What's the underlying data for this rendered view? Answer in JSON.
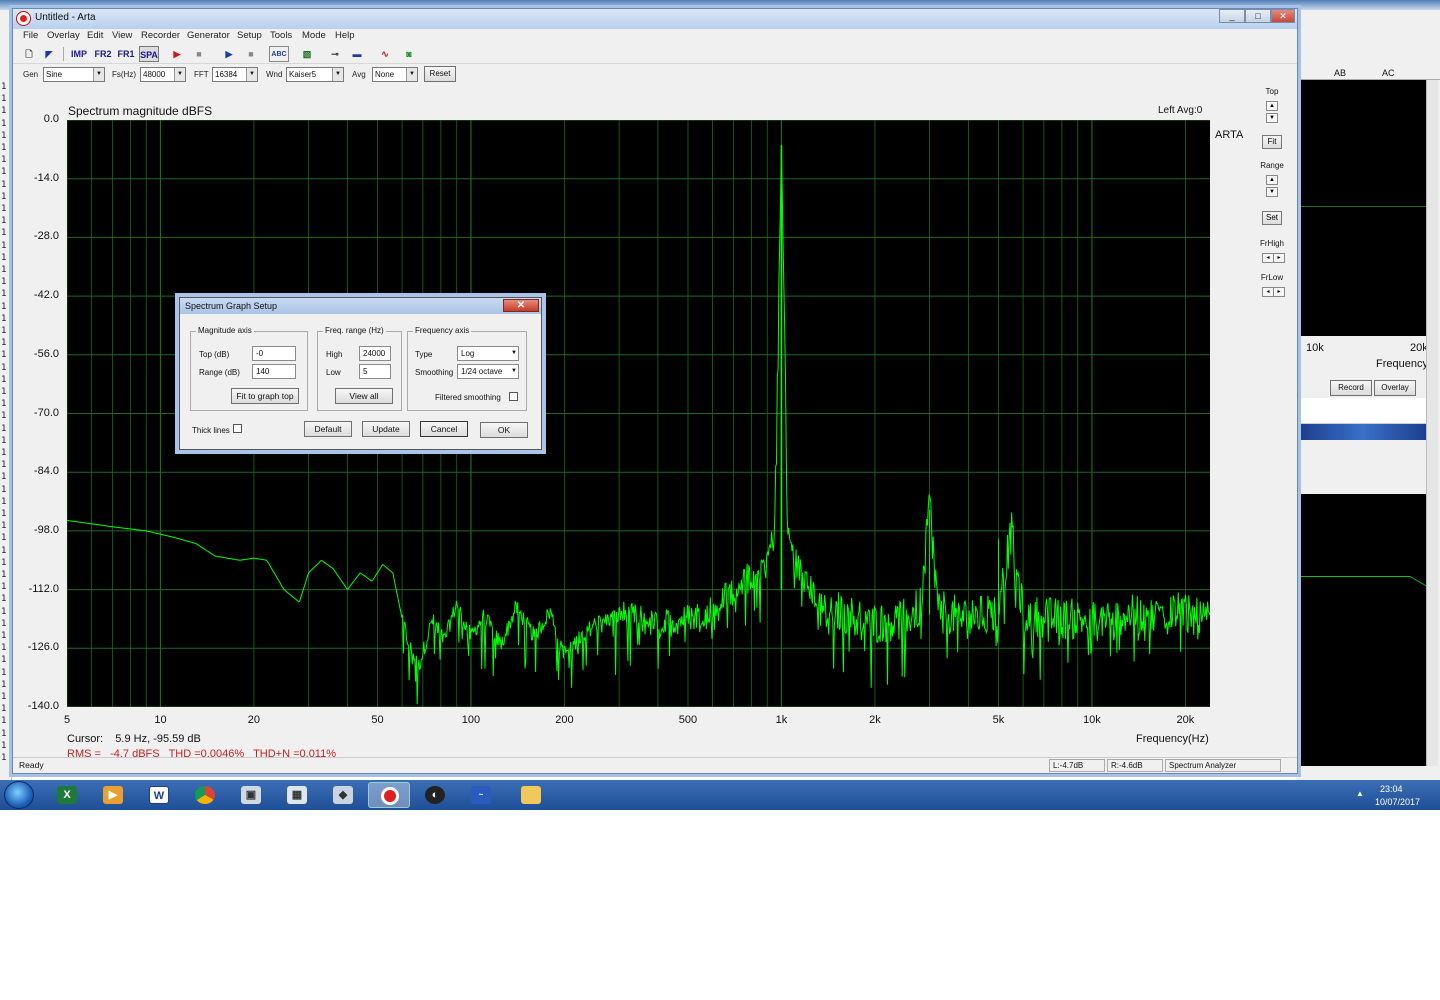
{
  "window": {
    "title": "Untitled - Arta",
    "controls": [
      "_",
      "□",
      "✕"
    ]
  },
  "menu": [
    "File",
    "Overlay",
    "Edit",
    "View",
    "Recorder",
    "Generator",
    "Setup",
    "Tools",
    "Mode",
    "Help"
  ],
  "toolbar": {
    "imp": "IMP",
    "fr2": "FR2",
    "fr1": "FR1",
    "spa": "SPA"
  },
  "controls": {
    "gen_label": "Gen",
    "gen_value": "Sine",
    "fs_label": "Fs(Hz)",
    "fs_value": "48000",
    "fft_label": "FFT",
    "fft_value": "16384",
    "wnd_label": "Wnd",
    "wnd_value": "Kaiser5",
    "avg_label": "Avg",
    "avg_value": "None",
    "reset_label": "Reset"
  },
  "graph": {
    "title": "Spectrum magnitude dBFS",
    "channel_info": "Left  Avg:0",
    "watermark": "ARTA",
    "xlabel": "Frequency(Hz)",
    "cursor": "Cursor:    5.9 Hz, -95.59 dB",
    "stats": "RMS =   -4.7 dBFS   THD =0.0046%   THD+N =0.011%"
  },
  "side_panel": {
    "top_label": "Top",
    "fit_label": "Fit",
    "range_label": "Range",
    "set_label": "Set",
    "frhigh_label": "FrHigh",
    "frlow_label": "FrLow"
  },
  "status_bar": {
    "ready": "Ready",
    "left_level": "L:-4.7dB",
    "right_level": "R:-4.6dB",
    "mode": "Spectrum Analyzer"
  },
  "dialog": {
    "title": "Spectrum Graph Setup",
    "magnitude_group": "Magnitude axis",
    "top_label": "Top (dB)",
    "top_value": "-0",
    "range_label": "Range (dB)",
    "range_value": "140",
    "fit_button": "Fit to graph top",
    "freq_group": "Freq. range (Hz)",
    "high_label": "High",
    "high_value": "24000",
    "low_label": "Low",
    "low_value": "5",
    "view_all_button": "View all",
    "freq_axis_group": "Frequency axis",
    "type_label": "Type",
    "type_value": "Log",
    "smoothing_label": "Smoothing",
    "smoothing_value": "1/24 octave",
    "filtered_smoothing_label": "Filtered smoothing",
    "thick_lines_label": "Thick lines",
    "default_button": "Default",
    "update_button": "Update",
    "cancel_button": "Cancel",
    "ok_button": "OK"
  },
  "right_window": {
    "col_ab": "AB",
    "col_ac": "AC",
    "x_10k": "10k",
    "x_20k": "20k",
    "frequency_label": "Frequency",
    "record_button": "Record",
    "overlay_button": "Overlay"
  },
  "taskbar": {
    "time": "23:04",
    "date": "10/07/2017"
  },
  "colors": {
    "trace": "#00ff00",
    "grid": "#1e6b1e",
    "plot_bg": "#000000",
    "stats_text": "#c62020"
  },
  "chart_data": {
    "type": "line",
    "title": "Spectrum magnitude dBFS",
    "xlabel": "Frequency(Hz)",
    "ylabel": "",
    "x_scale": "log",
    "xlim": [
      5,
      24000
    ],
    "ylim": [
      -140,
      0
    ],
    "x_ticks": [
      {
        "value": 5,
        "label": "5"
      },
      {
        "value": 10,
        "label": "10"
      },
      {
        "value": 20,
        "label": "20"
      },
      {
        "value": 50,
        "label": "50"
      },
      {
        "value": 100,
        "label": "100"
      },
      {
        "value": 200,
        "label": "200"
      },
      {
        "value": 500,
        "label": "500"
      },
      {
        "value": 1000,
        "label": "1k"
      },
      {
        "value": 2000,
        "label": "2k"
      },
      {
        "value": 5000,
        "label": "5k"
      },
      {
        "value": 10000,
        "label": "10k"
      },
      {
        "value": 20000,
        "label": "20k"
      }
    ],
    "y_ticks": [
      {
        "value": 0,
        "label": "0.0"
      },
      {
        "value": -14,
        "label": "-14.0"
      },
      {
        "value": -28,
        "label": "-28.0"
      },
      {
        "value": -42,
        "label": "-42.0"
      },
      {
        "value": -56,
        "label": "-56.0"
      },
      {
        "value": -70,
        "label": "-70.0"
      },
      {
        "value": -84,
        "label": "-84.0"
      },
      {
        "value": -98,
        "label": "-98.0"
      },
      {
        "value": -112,
        "label": "-112.0"
      },
      {
        "value": -126,
        "label": "-126.0"
      },
      {
        "value": -140,
        "label": "-140.0"
      }
    ],
    "grid": true,
    "series": [
      {
        "x": [
          5,
          7,
          9,
          11,
          13,
          15,
          18,
          20,
          22,
          25,
          28,
          30,
          33,
          36,
          40,
          44,
          48,
          52,
          56,
          62,
          68,
          75,
          82,
          90,
          100,
          110,
          125,
          140,
          160,
          180,
          200,
          250,
          300,
          400,
          500,
          600,
          700,
          800,
          900,
          950,
          1000,
          1050,
          1100,
          1200,
          1400,
          1600,
          2000,
          2500,
          2800,
          3000,
          3200,
          4000,
          5000,
          5500,
          6000,
          8000,
          10000,
          12000,
          15000,
          18000,
          20000,
          24000
        ],
        "y": [
          -95.5,
          -97,
          -98,
          -99.5,
          -101,
          -104,
          -105,
          -104.5,
          -105,
          -112,
          -115,
          -108,
          -105,
          -107,
          -112,
          -108,
          -110,
          -106,
          -108,
          -124,
          -131,
          -120,
          -125,
          -116,
          -124,
          -119,
          -126,
          -117,
          -124,
          -118,
          -128,
          -121,
          -119,
          -122,
          -120,
          -118,
          -113,
          -110,
          -106,
          -100,
          -6,
          -100,
          -106,
          -112,
          -118,
          -120,
          -122,
          -121,
          -118,
          -93,
          -119,
          -121,
          -119,
          -100,
          -120,
          -121,
          -121,
          -120,
          -120,
          -119,
          -120,
          -122
        ]
      }
    ],
    "annotations": {
      "fundamental": {
        "x": 1000,
        "y": -6
      },
      "harmonics": [
        {
          "x": 3000,
          "y": -93
        },
        {
          "x": 5000,
          "y": -100
        }
      ],
      "noise_floor_range": [
        -140,
        -112
      ]
    }
  }
}
